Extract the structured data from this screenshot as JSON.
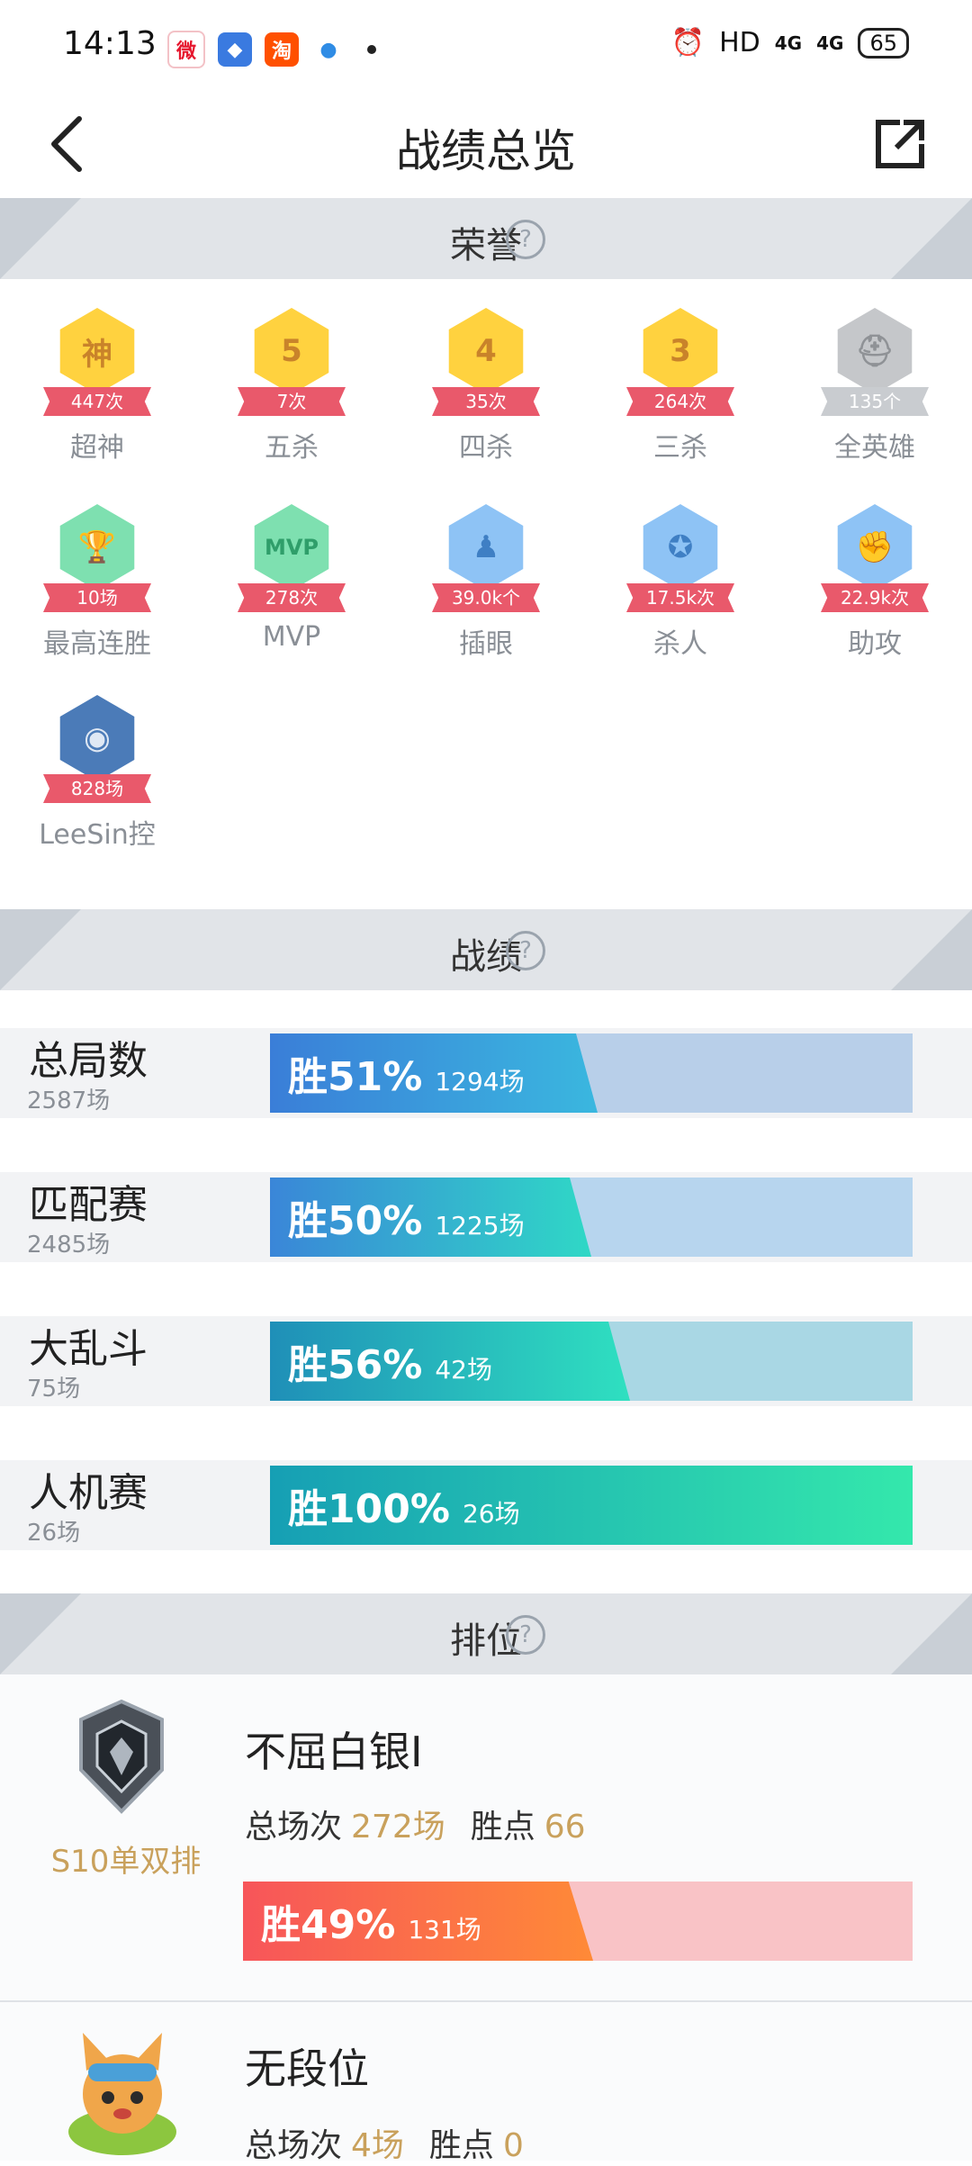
{
  "status_bar": {
    "time": "14:13",
    "apps": [
      {
        "name": "weibo-icon",
        "glyph": "微",
        "color": "#e6162d"
      },
      {
        "name": "cloud-icon",
        "glyph": "◆",
        "color": "#3a7ae0"
      },
      {
        "name": "taobao-icon",
        "glyph": "淘",
        "color": "#ff5000"
      },
      {
        "name": "app-dot-icon",
        "glyph": "●",
        "color": "#2f8ce5"
      }
    ],
    "hd": "HD",
    "net1": "4G",
    "net2": "4G",
    "battery": "65"
  },
  "header": {
    "title": "战绩总览"
  },
  "sections": {
    "honor": "荣誉",
    "record": "战绩",
    "rank": "排位"
  },
  "honors": [
    {
      "label": "超神",
      "count": "447次",
      "glyph": "神",
      "bg": "#ffd23f",
      "fg": "#c9832a",
      "ribbon": "red"
    },
    {
      "label": "五杀",
      "count": "7次",
      "glyph": "5",
      "bg": "#ffd23f",
      "fg": "#c9832a",
      "ribbon": "red"
    },
    {
      "label": "四杀",
      "count": "35次",
      "glyph": "4",
      "bg": "#ffd23f",
      "fg": "#c9832a",
      "ribbon": "red"
    },
    {
      "label": "三杀",
      "count": "264次",
      "glyph": "3",
      "bg": "#ffd23f",
      "fg": "#c9832a",
      "ribbon": "red"
    },
    {
      "label": "全英雄",
      "count": "135个",
      "glyph": "⛑",
      "bg": "#c5c7ca",
      "fg": "#8f9296",
      "ribbon": "grey"
    },
    {
      "label": "最高连胜",
      "count": "10场",
      "glyph": "🏆",
      "bg": "#7ee0b0",
      "fg": "#2f9e6a",
      "ribbon": "red"
    },
    {
      "label": "MVP",
      "count": "278次",
      "glyph": "MVP",
      "bg": "#7ee0b0",
      "fg": "#2f9e6a",
      "ribbon": "red"
    },
    {
      "label": "插眼",
      "count": "39.0k个",
      "glyph": "♟",
      "bg": "#8ec3f5",
      "fg": "#3f7fc4",
      "ribbon": "red"
    },
    {
      "label": "杀人",
      "count": "17.5k次",
      "glyph": "✪",
      "bg": "#8ec3f5",
      "fg": "#3f7fc4",
      "ribbon": "red"
    },
    {
      "label": "助攻",
      "count": "22.9k次",
      "glyph": "✊",
      "bg": "#8ec3f5",
      "fg": "#3f7fc4",
      "ribbon": "red"
    },
    {
      "label": "LeeSin控",
      "count": "828场",
      "glyph": "◉",
      "bg": "#4b7bb8",
      "fg": "#dfe8f4",
      "ribbon": "red"
    }
  ],
  "stats": [
    {
      "name": "总局数",
      "total": "2587场",
      "win_label": "胜51%",
      "wins": "1294场",
      "win_rate": 51,
      "fill": "linear-gradient(90deg,#3a7ed8,#3ab7df)",
      "bg": "#b8cfe9"
    },
    {
      "name": "匹配赛",
      "total": "2485场",
      "win_label": "胜50%",
      "wins": "1225场",
      "win_rate": 50,
      "fill": "linear-gradient(90deg,#3a86d8,#2fd8c6)",
      "bg": "#b7d5ee"
    },
    {
      "name": "大乱斗",
      "total": "75场",
      "win_label": "胜56%",
      "wins": "42场",
      "win_rate": 56,
      "fill": "linear-gradient(90deg,#1f8fb8,#2fe0c0)",
      "bg": "#a9d7e4"
    },
    {
      "name": "人机赛",
      "total": "26场",
      "win_label": "胜100%",
      "wins": "26场",
      "win_rate": 100,
      "fill": "linear-gradient(90deg,#169fb4,#34e8ac)",
      "bg": "#a9e4d8"
    }
  ],
  "ranks": [
    {
      "mode": "S10单双排",
      "tier": "不屈白银Ⅰ",
      "games_label": "总场次",
      "games": "272场",
      "points_label": "胜点",
      "points": "66",
      "win_label": "胜49%",
      "wins": "131场",
      "win_rate": 49
    },
    {
      "tier": "无段位",
      "games_label": "总场次",
      "games": "4场",
      "points_label": "胜点",
      "points": "0"
    }
  ]
}
